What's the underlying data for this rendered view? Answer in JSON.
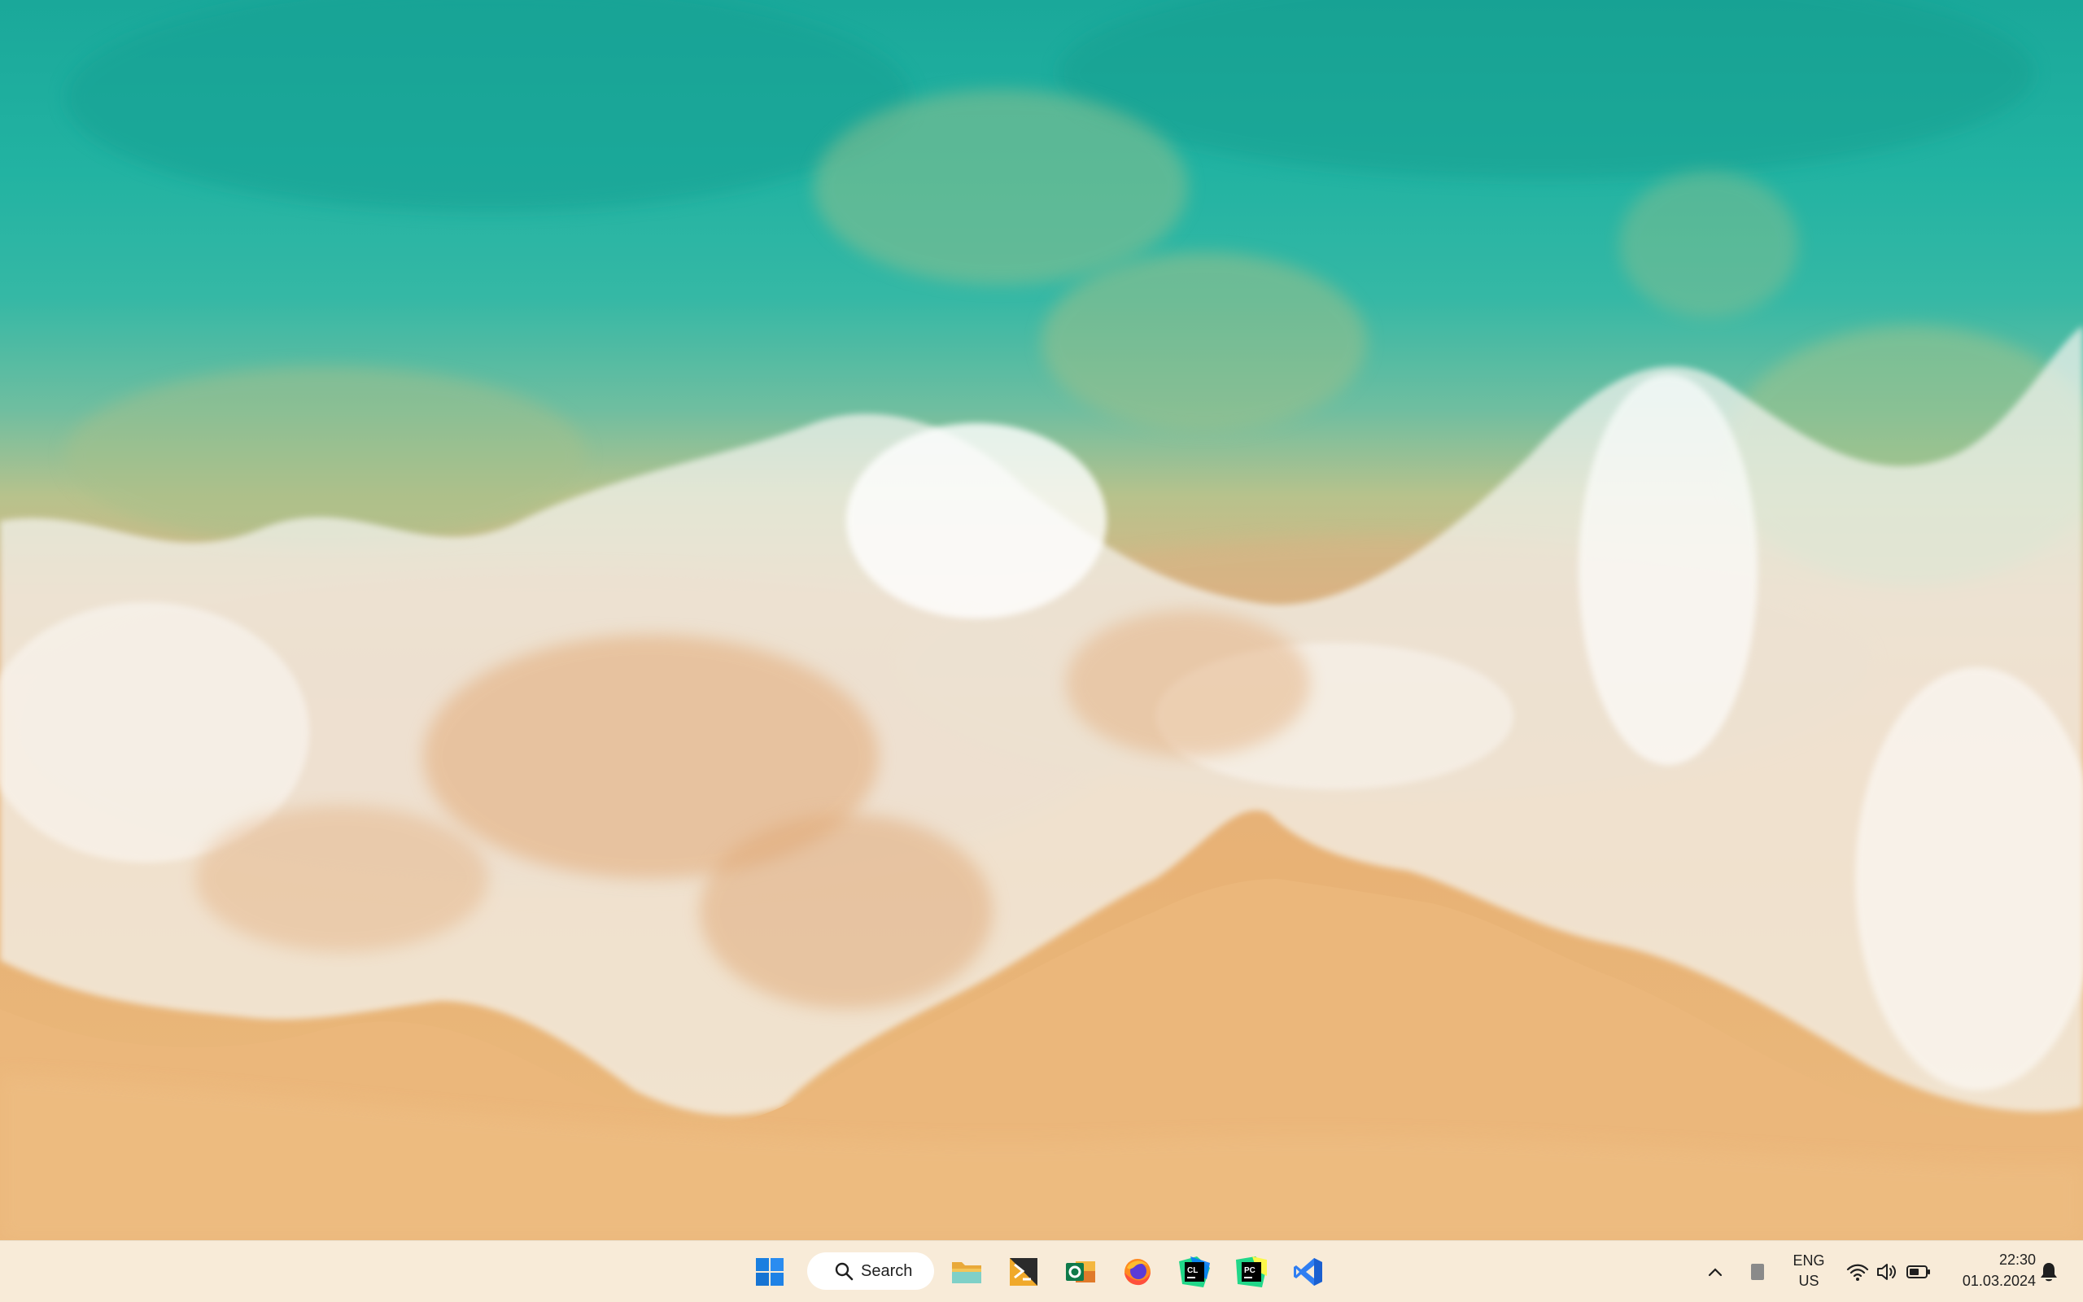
{
  "wallpaper": {
    "description_icon": "beach-waves-wallpaper"
  },
  "taskbar": {
    "start_icon": "windows-logo-icon",
    "search": {
      "label": "Search",
      "icon": "search-icon"
    },
    "pinned_apps": [
      {
        "icon": "file-explorer-icon",
        "accent": "#e9a93a"
      },
      {
        "icon": "powershell-icon",
        "accent": "#f0a92b"
      },
      {
        "icon": "outlook-icon",
        "accent": "#0f7a4a"
      },
      {
        "icon": "firefox-icon",
        "accent": "#ff8a1f"
      },
      {
        "icon": "clion-icon",
        "accent": "#21d789"
      },
      {
        "icon": "pycharm-icon",
        "accent": "#21d789"
      },
      {
        "icon": "visual-studio-icon",
        "accent": "#2f7ef2"
      }
    ],
    "tray": {
      "chevron_icon": "chevron-up-icon",
      "language_line1": "ENG",
      "language_line2": "US",
      "wifi_icon": "wifi-icon",
      "volume_icon": "volume-icon",
      "battery_icon": "battery-icon",
      "time": "22:30",
      "date": "01.03.2024",
      "notification_icon": "bell-icon"
    }
  }
}
